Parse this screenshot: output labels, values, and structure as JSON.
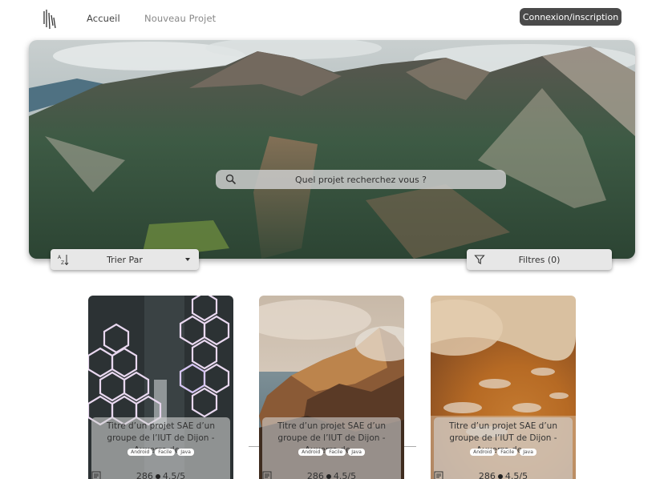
{
  "header": {
    "logo_icon": "bars-logo-icon",
    "nav": [
      {
        "label": "Accueil"
      },
      {
        "label": "Nouveau Projet"
      }
    ],
    "auth_label": "Connexion/inscription"
  },
  "hero": {
    "search_placeholder": "Quel projet recherchez vous ?",
    "search_icon": "search-icon"
  },
  "sort": {
    "label": "Trier Par",
    "icon": "sort-az-icon"
  },
  "filter": {
    "label": "Filtres (0)",
    "icon": "filter-funnel-icon"
  },
  "cards": [
    {
      "title": "Titre d’un projet SAE d’un groupe de l’IUT de Dijon - Auxerre de...",
      "tags": [
        "Android",
        "Facile",
        "Java"
      ],
      "views": "286",
      "rating": "4.5/5"
    },
    {
      "title": "Titre d’un projet SAE d’un groupe de l’IUT de Dijon - Auxerre de...",
      "tags": [
        "Android",
        "Facile",
        "Java"
      ],
      "views": "286",
      "rating": "4.5/5"
    },
    {
      "title": "Titre d’un projet SAE d’un groupe de l’IUT de Dijon - Auxerre de...",
      "tags": [
        "Android",
        "Facile",
        "Java"
      ],
      "views": "286",
      "rating": "4.5/5"
    }
  ]
}
